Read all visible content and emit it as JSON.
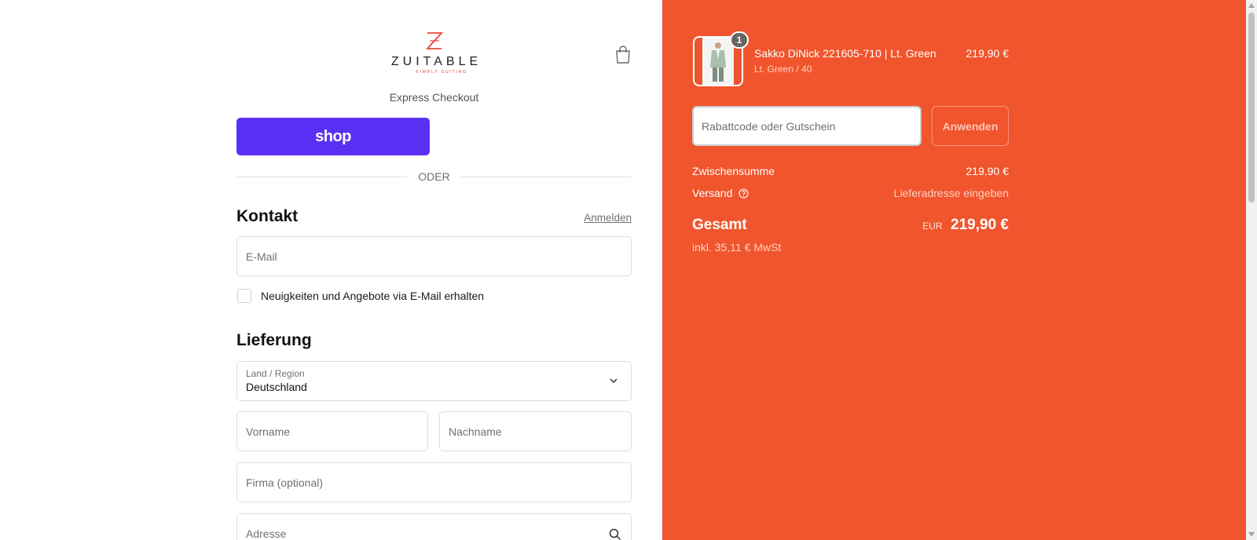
{
  "brand": {
    "name": "ZUITABLE",
    "tagline": "SIMPLY SUITING"
  },
  "colors": {
    "accent": "#f1552d",
    "shop_pay": "#5a31f4"
  },
  "express": {
    "title": "Express Checkout",
    "shop_label": "shop"
  },
  "divider": "ODER",
  "contact": {
    "heading": "Kontakt",
    "login_link": "Anmelden",
    "email_placeholder": "E-Mail",
    "newsletter_label": "Neuigkeiten und Angebote via E-Mail erhalten"
  },
  "delivery": {
    "heading": "Lieferung",
    "country_label": "Land / Region",
    "country_value": "Deutschland",
    "first_name_placeholder": "Vorname",
    "last_name_placeholder": "Nachname",
    "company_placeholder": "Firma (optional)",
    "address_placeholder": "Adresse"
  },
  "cart": {
    "item": {
      "quantity": "1",
      "title": "Sakko DiNick 221605-710 | Lt. Green",
      "variant": "Lt. Green / 40",
      "price": "219,90 €"
    },
    "discount_placeholder": "Rabattcode oder Gutschein",
    "apply_label": "Anwenden",
    "subtotal_label": "Zwischensumme",
    "subtotal_value": "219,90 €",
    "shipping_label": "Versand",
    "shipping_value": "Lieferadresse eingeben",
    "total_label": "Gesamt",
    "total_currency": "EUR",
    "total_value": "219,90 €",
    "tax_note": "inkl. 35,11 € MwSt"
  }
}
